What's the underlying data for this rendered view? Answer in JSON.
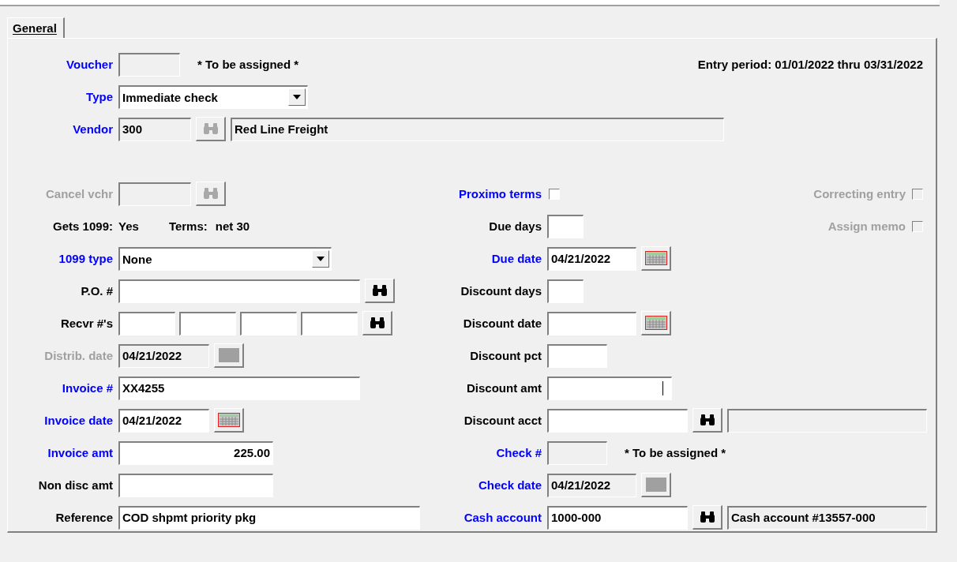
{
  "tabs": [
    {
      "label": "General",
      "selected": true
    }
  ],
  "entry_period": "Entry period: 01/01/2022 thru 03/31/2022",
  "left": [
    {
      "kind": "text",
      "label": "Voucher",
      "required": true,
      "disabled": false,
      "inputs": [
        {
          "disabled": true
        }
      ],
      "note": "* To be assigned *"
    },
    {
      "kind": "select",
      "label": "Type",
      "required": true,
      "disabled": false,
      "value": "Immediate check"
    },
    {
      "kind": "text",
      "label": "Vendor",
      "required": true,
      "disabled": false,
      "inputs": [
        {
          "disabled": true,
          "value": "300"
        }
      ],
      "button": {
        "kind": "lookup",
        "disabled": true
      },
      "after": [
        {
          "disabled": true,
          "value": "Red Line Freight"
        }
      ]
    },
    {
      "kind": "text",
      "label": "Cancel vchr",
      "required": false,
      "disabled": true,
      "inputs": [
        {
          "disabled": true
        }
      ],
      "button": {
        "kind": "lookup",
        "disabled": true
      }
    },
    {
      "kind": "info",
      "label": "Gets 1099:",
      "value": "Yes",
      "terms": {
        "label": "Terms:",
        "value": "net 30"
      }
    },
    {
      "kind": "select",
      "label": "1099 type",
      "required": true,
      "disabled": false,
      "value": "None"
    },
    {
      "kind": "text",
      "label": "P.O. #",
      "required": false,
      "disabled": false,
      "inputs": [
        {
          "disabled": false
        }
      ],
      "button": {
        "kind": "lookup",
        "disabled": false
      }
    },
    {
      "kind": "text",
      "label": "Recvr #'s",
      "required": false,
      "disabled": false,
      "inputs": [
        {
          "disabled": false
        },
        {
          "disabled": false
        },
        {
          "disabled": false
        },
        {
          "disabled": false
        }
      ],
      "button": {
        "kind": "lookup",
        "disabled": false
      }
    },
    {
      "kind": "text",
      "label": "Distrib. date",
      "required": false,
      "disabled": true,
      "inputs": [
        {
          "disabled": true,
          "value": "04/21/2022"
        }
      ],
      "button": {
        "kind": "calendar",
        "disabled": true
      }
    },
    {
      "kind": "text",
      "label": "Invoice #",
      "required": true,
      "disabled": false,
      "inputs": [
        {
          "disabled": false,
          "value": "XX4255"
        }
      ]
    },
    {
      "kind": "text",
      "label": "Invoice date",
      "required": true,
      "disabled": false,
      "inputs": [
        {
          "disabled": false,
          "value": "04/21/2022"
        }
      ],
      "button": {
        "kind": "calendar",
        "disabled": false
      }
    },
    {
      "kind": "text",
      "label": "Invoice amt",
      "required": true,
      "disabled": false,
      "inputs": [
        {
          "disabled": false,
          "value": "225.00",
          "numeric": true
        }
      ]
    },
    {
      "kind": "text",
      "label": "Non disc amt",
      "required": false,
      "disabled": false,
      "inputs": [
        {
          "disabled": false
        }
      ]
    },
    {
      "kind": "text",
      "label": "Reference",
      "required": false,
      "disabled": false,
      "inputs": [
        {
          "disabled": false,
          "value": "COD shpmt priority pkg"
        }
      ]
    }
  ],
  "right": [
    {
      "kind": "checkbox",
      "label": "Proximo terms",
      "required": true,
      "disabled": false,
      "checked": false
    },
    {
      "kind": "text",
      "label": "Due days",
      "required": false,
      "disabled": false,
      "inputs": [
        {
          "disabled": false
        }
      ]
    },
    {
      "kind": "text",
      "label": "Due date",
      "required": true,
      "disabled": false,
      "inputs": [
        {
          "disabled": false,
          "value": "04/21/2022"
        }
      ],
      "button": {
        "kind": "calendar",
        "disabled": false
      }
    },
    {
      "kind": "text",
      "label": "Discount days",
      "required": false,
      "disabled": false,
      "inputs": [
        {
          "disabled": false
        }
      ]
    },
    {
      "kind": "text",
      "label": "Discount date",
      "required": false,
      "disabled": false,
      "inputs": [
        {
          "disabled": false
        }
      ],
      "button": {
        "kind": "calendar",
        "disabled": false
      }
    },
    {
      "kind": "text",
      "label": "Discount pct",
      "required": false,
      "disabled": false,
      "inputs": [
        {
          "disabled": false
        }
      ]
    },
    {
      "kind": "text",
      "label": "Discount amt",
      "required": false,
      "disabled": false,
      "inputs": [
        {
          "disabled": false,
          "focused": true
        }
      ]
    },
    {
      "kind": "text",
      "label": "Discount acct",
      "required": false,
      "disabled": false,
      "inputs": [
        {
          "disabled": false
        }
      ],
      "button": {
        "kind": "lookup",
        "disabled": false
      },
      "after": [
        {
          "disabled": true
        }
      ]
    },
    {
      "kind": "text",
      "label": "Check #",
      "required": true,
      "disabled": false,
      "inputs": [
        {
          "disabled": true
        }
      ],
      "note": "* To be assigned *"
    },
    {
      "kind": "text",
      "label": "Check date",
      "required": true,
      "disabled": false,
      "inputs": [
        {
          "disabled": true,
          "value": "04/21/2022"
        }
      ],
      "button": {
        "kind": "calendar",
        "disabled": true
      }
    },
    {
      "kind": "text",
      "label": "Cash account",
      "required": true,
      "disabled": false,
      "inputs": [
        {
          "disabled": false,
          "value": "1000-000"
        }
      ],
      "button": {
        "kind": "lookup",
        "disabled": false
      },
      "after": [
        {
          "disabled": true,
          "value": "Cash account #13557-000"
        }
      ]
    }
  ],
  "flags": [
    {
      "label": "Correcting entry",
      "checked": false,
      "disabled": true
    },
    {
      "label": "Assign memo",
      "checked": false,
      "disabled": true
    }
  ]
}
